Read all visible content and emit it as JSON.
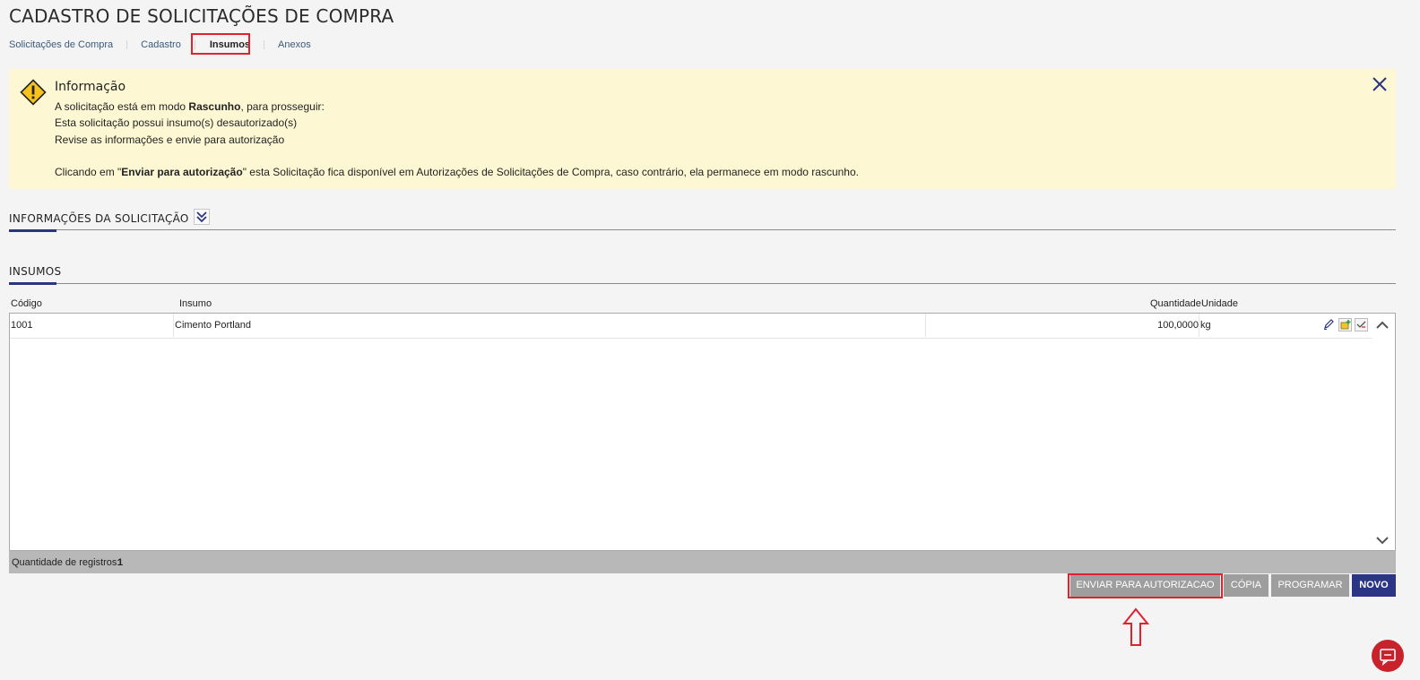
{
  "page": {
    "title": "CADASTRO DE SOLICITAÇÕES DE COMPRA"
  },
  "tabs": [
    {
      "label": "Solicitações de Compra"
    },
    {
      "label": "Cadastro"
    },
    {
      "label": "Insumos"
    },
    {
      "label": "Anexos"
    }
  ],
  "info": {
    "title": "Informação",
    "line1_pre": "A solicitação está em modo ",
    "line1_bold": "Rascunho",
    "line1_post": ", para prosseguir:",
    "line2": "Esta solicitação possui insumo(s) desautorizado(s)",
    "line3": "Revise as informações e envie para autorização",
    "line4_pre": "Clicando em \"",
    "line4_bold": "Enviar para autorização",
    "line4_post": "\" esta Solicitação fica disponível em Autorizações de Solicitações de Compra, caso contrário, ela permanece em modo rascunho."
  },
  "sections": {
    "info_solicitacao": "INFORMAÇÕES DA SOLICITAÇÃO",
    "insumos": "INSUMOS"
  },
  "table": {
    "columns": [
      "Código",
      "Insumo",
      "Quantidade",
      "Unidade"
    ],
    "rows": [
      {
        "codigo": "1001",
        "insumo": "Cimento Portland",
        "quantidade": "100,0000",
        "unidade": "kg"
      }
    ],
    "footer_label": "Quantidade de registros:",
    "footer_count": "1"
  },
  "buttons": {
    "enviar": "ENVIAR PARA AUTORIZACAO",
    "copia": "CÓPIA",
    "programar": "PROGRAMAR",
    "novo": "NOVO"
  },
  "colors": {
    "accent_navy": "#2b3585",
    "highlight_red": "#e0212e",
    "info_bg": "#fdf8d3",
    "button_gray": "#9e9e9e"
  },
  "icons": [
    "warning-icon",
    "close-icon",
    "chevron-double-down-icon",
    "pencil-icon",
    "add-item-icon",
    "approve-icon",
    "scroll-up-icon",
    "scroll-down-icon",
    "arrow-up-icon",
    "chat-icon"
  ]
}
